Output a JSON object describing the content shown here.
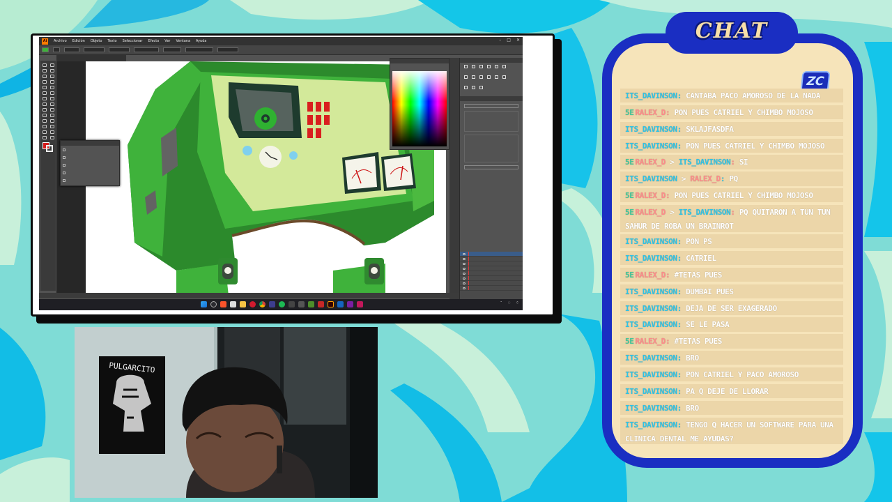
{
  "illustrator": {
    "menu": [
      "Archivo",
      "Edición",
      "Objeto",
      "Texto",
      "Seleccionar",
      "Efecto",
      "Ver",
      "Ventana",
      "Ayuda"
    ]
  },
  "chat": {
    "title": "CHAT",
    "logo_text": "ZC",
    "messages": [
      {
        "badge": "",
        "user": "ITS_DAVINSON",
        "user_color": "cyan",
        "to": "",
        "text": "CANTABA PACO AMOROSO DE LA NADA"
      },
      {
        "badge": "5E",
        "user": "RALEX_D",
        "user_color": "pink",
        "to": "",
        "text": "PON PUES CATRIEL Y CHIMBO MOJOSO"
      },
      {
        "badge": "",
        "user": "ITS_DAVINSON",
        "user_color": "cyan",
        "to": "",
        "text": "SKLAJFASDFA"
      },
      {
        "badge": "",
        "user": "ITS_DAVINSON",
        "user_color": "cyan",
        "to": "",
        "text": "PON PUES CATRIEL Y CHIMBO MOJOSO"
      },
      {
        "badge": "5E",
        "user": "RALEX_D",
        "user_color": "pink",
        "to": "ITS_DAVINSON",
        "text": "SI"
      },
      {
        "badge": "",
        "user": "ITS_DAVINSON",
        "user_color": "cyan",
        "to": "RALEX_D",
        "text": "PQ"
      },
      {
        "badge": "5E",
        "user": "RALEX_D",
        "user_color": "pink",
        "to": "",
        "text": "PON PUES CATRIEL Y CHIMBO MOJOSO"
      },
      {
        "badge": "5E",
        "user": "RALEX_D",
        "user_color": "pink",
        "to": "ITS_DAVINSON",
        "text": "PQ QUITARON A TUN TUN SAHUR DE ROBA UN BRAINROT"
      },
      {
        "badge": "",
        "user": "ITS_DAVINSON",
        "user_color": "cyan",
        "to": "",
        "text": "PON PS"
      },
      {
        "badge": "",
        "user": "ITS_DAVINSON",
        "user_color": "cyan",
        "to": "",
        "text": "CATRIEL"
      },
      {
        "badge": "5E",
        "user": "RALEX_D",
        "user_color": "pink",
        "to": "",
        "text": "#TETAS PUES"
      },
      {
        "badge": "",
        "user": "ITS_DAVINSON",
        "user_color": "cyan",
        "to": "",
        "text": "DUMBAI PUES"
      },
      {
        "badge": "",
        "user": "ITS_DAVINSON",
        "user_color": "cyan",
        "to": "",
        "text": "DEJA DE SER EXAGERADO"
      },
      {
        "badge": "",
        "user": "ITS_DAVINSON",
        "user_color": "cyan",
        "to": "",
        "text": "SE LE PASA"
      },
      {
        "badge": "5E",
        "user": "RALEX_D",
        "user_color": "pink",
        "to": "",
        "text": "#TETAS PUES"
      },
      {
        "badge": "",
        "user": "ITS_DAVINSON",
        "user_color": "cyan",
        "to": "",
        "text": "BRO"
      },
      {
        "badge": "",
        "user": "ITS_DAVINSON",
        "user_color": "cyan",
        "to": "",
        "text": "PON CATRIEL Y PACO AMOROSO"
      },
      {
        "badge": "",
        "user": "ITS_DAVINSON",
        "user_color": "cyan",
        "to": "",
        "text": "PA Q DEJE DE LLORAR"
      },
      {
        "badge": "",
        "user": "ITS_DAVINSON",
        "user_color": "cyan",
        "to": "",
        "text": "BRO"
      },
      {
        "badge": "",
        "user": "ITS_DAVINSON",
        "user_color": "cyan",
        "to": "",
        "text": "TENGO Q HACER UN SOFTWARE PARA UNA CLINICA DENTAL ME AYUDAS?"
      }
    ]
  },
  "webcam": {
    "poster_text": "PULGARCITO"
  },
  "colors": {
    "chat_border": "#1a2ec2",
    "chat_fill": "#f6e4ba",
    "message_bar": "#ecd6a9",
    "user_cyan": "#2ec3e6",
    "user_pink": "#ff8a8a",
    "badge": "#43c79a",
    "robot_green": "#3fb23b"
  }
}
